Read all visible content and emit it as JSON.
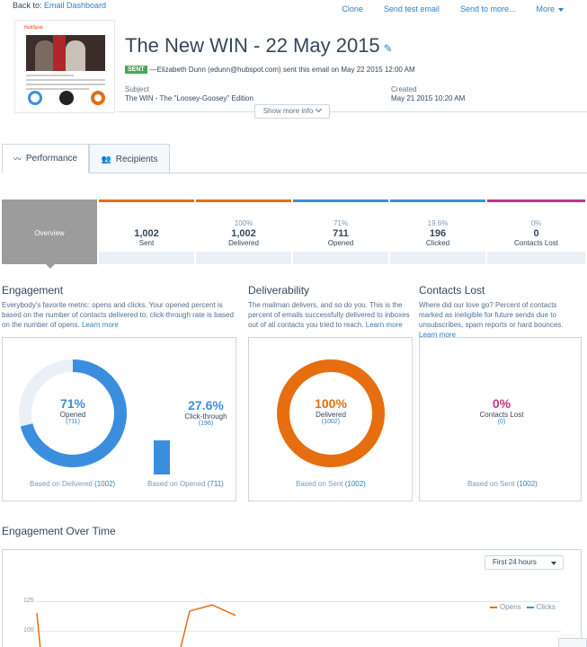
{
  "topbar": {
    "back_prefix": "Back to:",
    "back_link": "Email Dashboard",
    "actions": [
      "Clone",
      "Send test email",
      "Send to more...",
      "More"
    ]
  },
  "header": {
    "title": "The New WIN - 22 May 2015",
    "status": "SENT",
    "sent_line": "—Elizabeth Dunn (edunn@hubspot.com) sent this email on May 22 2015 12:00 AM",
    "subject_label": "Subject",
    "subject_value": "The WIN - The \"Loosey-Goosey\" Edition",
    "created_label": "Created",
    "created_value": "May 21 2015 10:20 AM",
    "show_more": "Show more info",
    "thumb_logo": "HubSpot"
  },
  "tabs": [
    {
      "label": "Performance",
      "icon": "pulse-icon"
    },
    {
      "label": "Recipients",
      "icon": "people-icon"
    }
  ],
  "stats": {
    "overview_label": "Overview",
    "cells": [
      {
        "pct": "",
        "num": "1,002",
        "label": "Sent",
        "color": "#e66e0f"
      },
      {
        "pct": "100%",
        "num": "1,002",
        "label": "Delivered",
        "color": "#e66e0f"
      },
      {
        "pct": "71%",
        "num": "711",
        "label": "Opened",
        "color": "#3b8ede"
      },
      {
        "pct": "19.6%",
        "num": "196",
        "label": "Clicked",
        "color": "#3b8ede"
      },
      {
        "pct": "0%",
        "num": "0",
        "label": "Contacts Lost",
        "color": "#c4338a"
      }
    ]
  },
  "engagement": {
    "title": "Engagement",
    "desc": "Everybody's favorite metric: opens and clicks. Your opened percent is based on the number of contacts delivered to; click-through rate is based on the number of opens.",
    "learn_more": "Learn more",
    "opened_pct": "71%",
    "opened_label": "Opened",
    "opened_count": "(711)",
    "opened_value": 0.71,
    "click_pct": "27.6%",
    "click_label": "Click-through",
    "click_count": "(196)",
    "click_value": 0.276,
    "based_delivered_prefix": "Based on Delivered",
    "based_delivered_count": "(1002)",
    "based_opened_prefix": "Based on Opened",
    "based_opened_count": "(711)"
  },
  "deliverability": {
    "title": "Deliverability",
    "desc": "The mailman delivers, and so do you. This is the percent of emails successfully delivered to inboxes out of all contacts you tried to reach.",
    "learn_more": "Learn more",
    "pct": "100%",
    "label": "Delivered",
    "count": "(1002)",
    "value": 1.0,
    "based_prefix": "Based on Sent",
    "based_count": "(1002)"
  },
  "contacts_lost": {
    "title": "Contacts Lost",
    "desc": "Where did our love go? Percent of contacts marked as ineligible for future sends due to unsubscribes, spam reports or hard bounces.",
    "learn_more": "Learn more",
    "pct": "0%",
    "label": "Contacts Lost",
    "count": "(0)",
    "based_prefix": "Based on Sent",
    "based_count": "(1002)"
  },
  "over_time": {
    "title": "Engagement Over Time",
    "range": "First 24 hours",
    "legend": [
      {
        "name": "Opens",
        "color": "#e66e0f"
      },
      {
        "name": "Clicks",
        "color": "#3b8ede"
      }
    ]
  },
  "chart_data": {
    "type": "line",
    "ylim": [
      0,
      125
    ],
    "yticks": [
      125,
      100
    ],
    "series": [
      {
        "name": "Opens",
        "values": [
          100,
          4,
          4,
          104,
          117,
          95
        ]
      },
      {
        "name": "Clicks",
        "values": []
      }
    ]
  },
  "colors": {
    "opened": "#3b8ede",
    "delivered": "#e66e0f",
    "lost": "#c4338a",
    "link": "#2d7fc1"
  }
}
